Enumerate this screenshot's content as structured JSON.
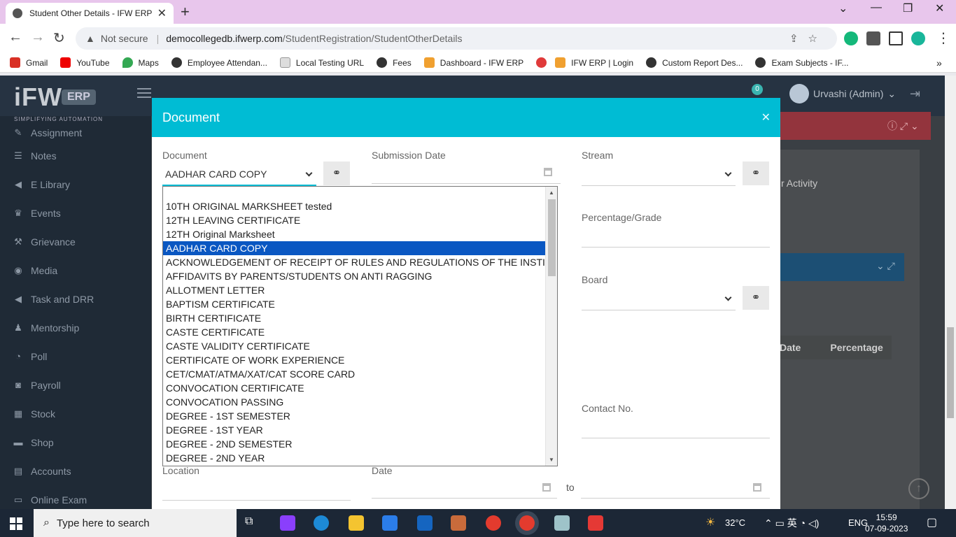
{
  "browser": {
    "tab_title": "Student Other Details - IFW ERP",
    "not_secure": "Not secure",
    "url_host": "democollegedb.ifwerp.com",
    "url_path": "/StudentRegistration/StudentOtherDetails",
    "bookmarks": [
      "Gmail",
      "YouTube",
      "Maps",
      "Employee Attendan...",
      "Local Testing URL",
      "Fees",
      "Dashboard - IFW ERP",
      "IFW ERP | Login",
      "Custom Report Des...",
      "Exam Subjects - IF..."
    ]
  },
  "app": {
    "logo_text": "iFW",
    "logo_erp": "ERP",
    "logo_tagline": "SIMPLIFYING AUTOMATION",
    "notification_count": "0",
    "user_name": "Urvashi (Admin)",
    "sidebar_items": [
      "Assignment",
      "Notes",
      "E Library",
      "Events",
      "Grievance",
      "Media",
      "Task and DRR",
      "Mentorship",
      "Poll",
      "Payroll",
      "Stock",
      "Shop",
      "Accounts",
      "Online Exam"
    ],
    "background_activity_text": "r Activity",
    "table_headers": [
      "Date",
      "Percentage"
    ]
  },
  "modal": {
    "title": "Document",
    "fields": {
      "document_label": "Document",
      "document_value": "AADHAR CARD COPY",
      "submission_date_label": "Submission Date",
      "stream_label": "Stream",
      "percentage_label": "Percentage/Grade",
      "board_label": "Board",
      "contact_label": "Contact No.",
      "location_label": "Location",
      "date_label": "Date",
      "to_label": "to"
    },
    "dropdown_options": [
      "",
      "10TH ORIGINAL MARKSHEET tested",
      "12TH LEAVING CERTIFICATE",
      "12TH Original Marksheet",
      "AADHAR CARD COPY",
      "ACKNOWLEDGEMENT OF RECEIPT OF RULES AND REGULATIONS OF THE INSTITUTE",
      "AFFIDAVITS BY PARENTS/STUDENTS ON ANTI RAGGING",
      "ALLOTMENT LETTER",
      "BAPTISM CERTIFICATE",
      "BIRTH CERTIFICATE",
      "CASTE CERTIFICATE",
      "CASTE VALIDITY CERTIFICATE",
      "CERTIFICATE OF WORK EXPERIENCE",
      "CET/CMAT/ATMA/XAT/CAT SCORE CARD",
      "CONVOCATION CERTIFICATE",
      "CONVOCATION PASSING",
      "DEGREE - 1ST SEMESTER",
      "DEGREE - 1ST YEAR",
      "DEGREE - 2ND SEMESTER",
      "DEGREE - 2ND YEAR"
    ],
    "selected_option": "AADHAR CARD COPY"
  },
  "taskbar": {
    "search_placeholder": "Type here to search",
    "weather": "32°C",
    "language": "ENG",
    "time": "15:59",
    "date": "07-09-2023"
  }
}
